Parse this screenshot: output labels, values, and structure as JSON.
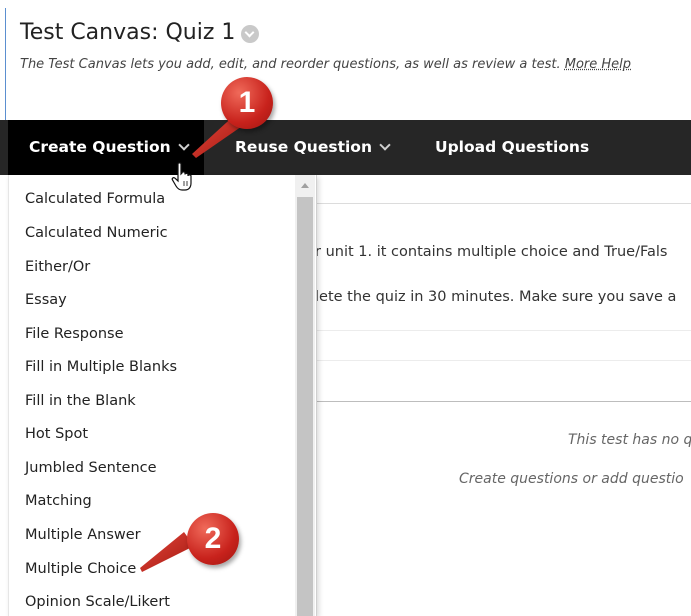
{
  "header": {
    "title": "Test Canvas: Quiz 1",
    "description": "The Test Canvas lets you add, edit, and reorder questions, as well as review a test.",
    "more_help": "More Help"
  },
  "navbar": {
    "create_question": "Create Question",
    "reuse_question": "Reuse Question",
    "upload_questions": "Upload Questions"
  },
  "content": {
    "line1": "r unit 1. it contains multiple choice and True/Fals",
    "line2": "lete the quiz in 30 minutes. Make sure you save a",
    "empty_title": "This test has no q",
    "empty_hint": "Create questions or add questio"
  },
  "dropdown": {
    "items": [
      "Calculated Formula",
      "Calculated Numeric",
      "Either/Or",
      "Essay",
      "File Response",
      "Fill in Multiple Blanks",
      "Fill in the Blank",
      "Hot Spot",
      "Jumbled Sentence",
      "Matching",
      "Multiple Answer",
      "Multiple Choice",
      "Opinion Scale/Likert"
    ]
  },
  "callouts": {
    "step1": "1",
    "step2": "2"
  },
  "colors": {
    "navbar_bg": "#262626",
    "active_tab_bg": "#000000",
    "callout_red": "#c8221c",
    "border_blue": "#5b8fd0"
  }
}
